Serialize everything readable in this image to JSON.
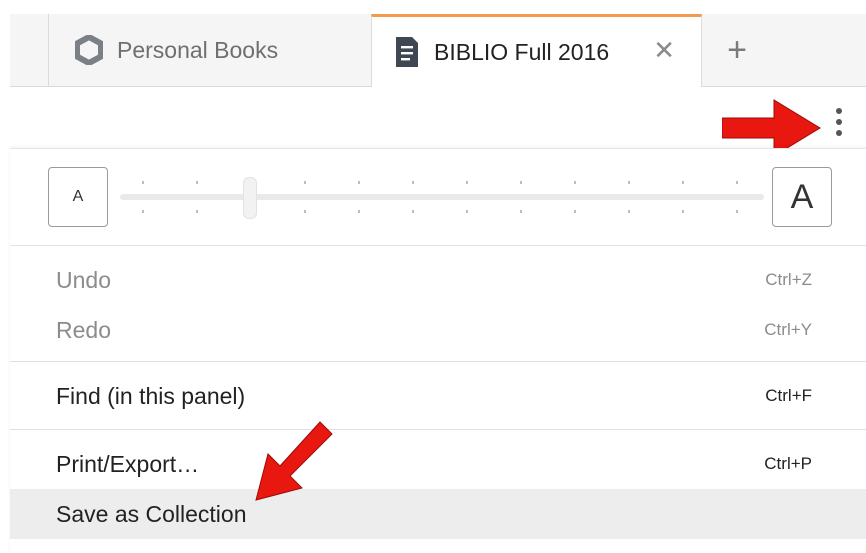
{
  "tabs": [
    {
      "label": "Personal Books",
      "icon": "hexagon-icon",
      "active": false
    },
    {
      "label": "BIBLIO Full 2016",
      "icon": "document-icon",
      "active": true,
      "close_glyph": "✕"
    }
  ],
  "add_tab_glyph": "+",
  "zoom": {
    "small_label": "A",
    "large_label": "A",
    "level_fraction": 0.2
  },
  "menu": {
    "undo": {
      "label": "Undo",
      "shortcut": "Ctrl+Z"
    },
    "redo": {
      "label": "Redo",
      "shortcut": "Ctrl+Y"
    },
    "find": {
      "label": "Find (in this panel)",
      "shortcut": "Ctrl+F"
    },
    "print": {
      "label": "Print/Export…",
      "shortcut": "Ctrl+P"
    },
    "save_collection": {
      "label": "Save as Collection"
    }
  },
  "colors": {
    "active_tab_accent": "#f39a4b",
    "annotation_arrow": "#e8170f",
    "hover_row": "#ededed"
  }
}
